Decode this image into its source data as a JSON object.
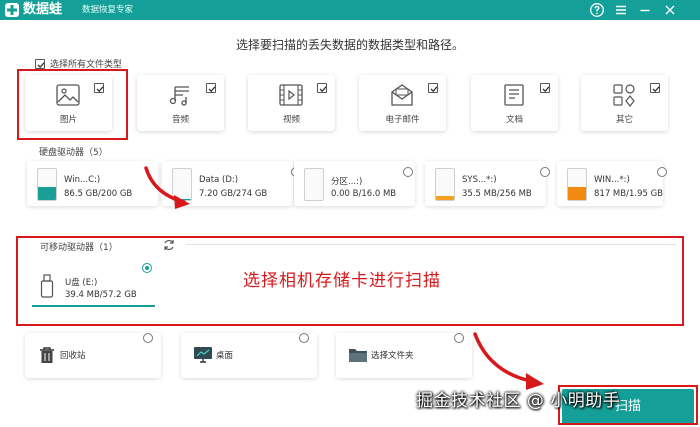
{
  "titlebar": {
    "app_name": "数据蛙",
    "subtitle": "数据恢复专家",
    "buttons": [
      "help-icon",
      "menu-icon",
      "minimize-icon",
      "close-icon"
    ]
  },
  "instruction": "选择要扫描的丢失数据的数据类型和路径。",
  "select_all": {
    "label": "选择所有文件类型",
    "checked": true
  },
  "file_types": [
    {
      "icon": "image-icon",
      "label": "图片",
      "checked": true
    },
    {
      "icon": "music-icon",
      "label": "音频",
      "checked": true
    },
    {
      "icon": "video-icon",
      "label": "视频",
      "checked": true
    },
    {
      "icon": "email-icon",
      "label": "电子邮件",
      "checked": true
    },
    {
      "icon": "document-icon",
      "label": "文档",
      "checked": true
    },
    {
      "icon": "other-icon",
      "label": "其它",
      "checked": true
    }
  ],
  "hard_drives": {
    "label": "硬盘驱动器（5）",
    "drives": [
      {
        "name": "Win...C:)",
        "size": "86.5 GB/200 GB",
        "fill": 0.43,
        "color": "#1a9e96"
      },
      {
        "name": "Data (D:)",
        "size": "7.20 GB/274 GB",
        "fill": 0.03,
        "color": "#1a9e96"
      },
      {
        "name": "分区...:)",
        "size": "0.00  B/16.0 MB",
        "fill": 0.0,
        "color": "#1a9e96"
      },
      {
        "name": "SYS...*:)",
        "size": "35.5 MB/256 MB",
        "fill": 0.14,
        "color": "#f2a21e"
      },
      {
        "name": "WIN...*:)",
        "size": "817 MB/1.95 GB",
        "fill": 0.42,
        "color": "#f08a10"
      }
    ]
  },
  "removable": {
    "label": "可移动驱动器（1）",
    "drive": {
      "name": "U盘 (E:)",
      "size": "39.4 MB/57.2 GB",
      "selected": true
    }
  },
  "annotation": "选择相机存储卡进行扫描",
  "locations": [
    {
      "icon": "recycle-bin-icon",
      "label": "回收站"
    },
    {
      "icon": "desktop-icon",
      "label": "桌面"
    },
    {
      "icon": "folder-icon",
      "label": "选择文件夹"
    }
  ],
  "scan_button": "扫描",
  "watermark": "掘金技术社区 @ 小明助手"
}
